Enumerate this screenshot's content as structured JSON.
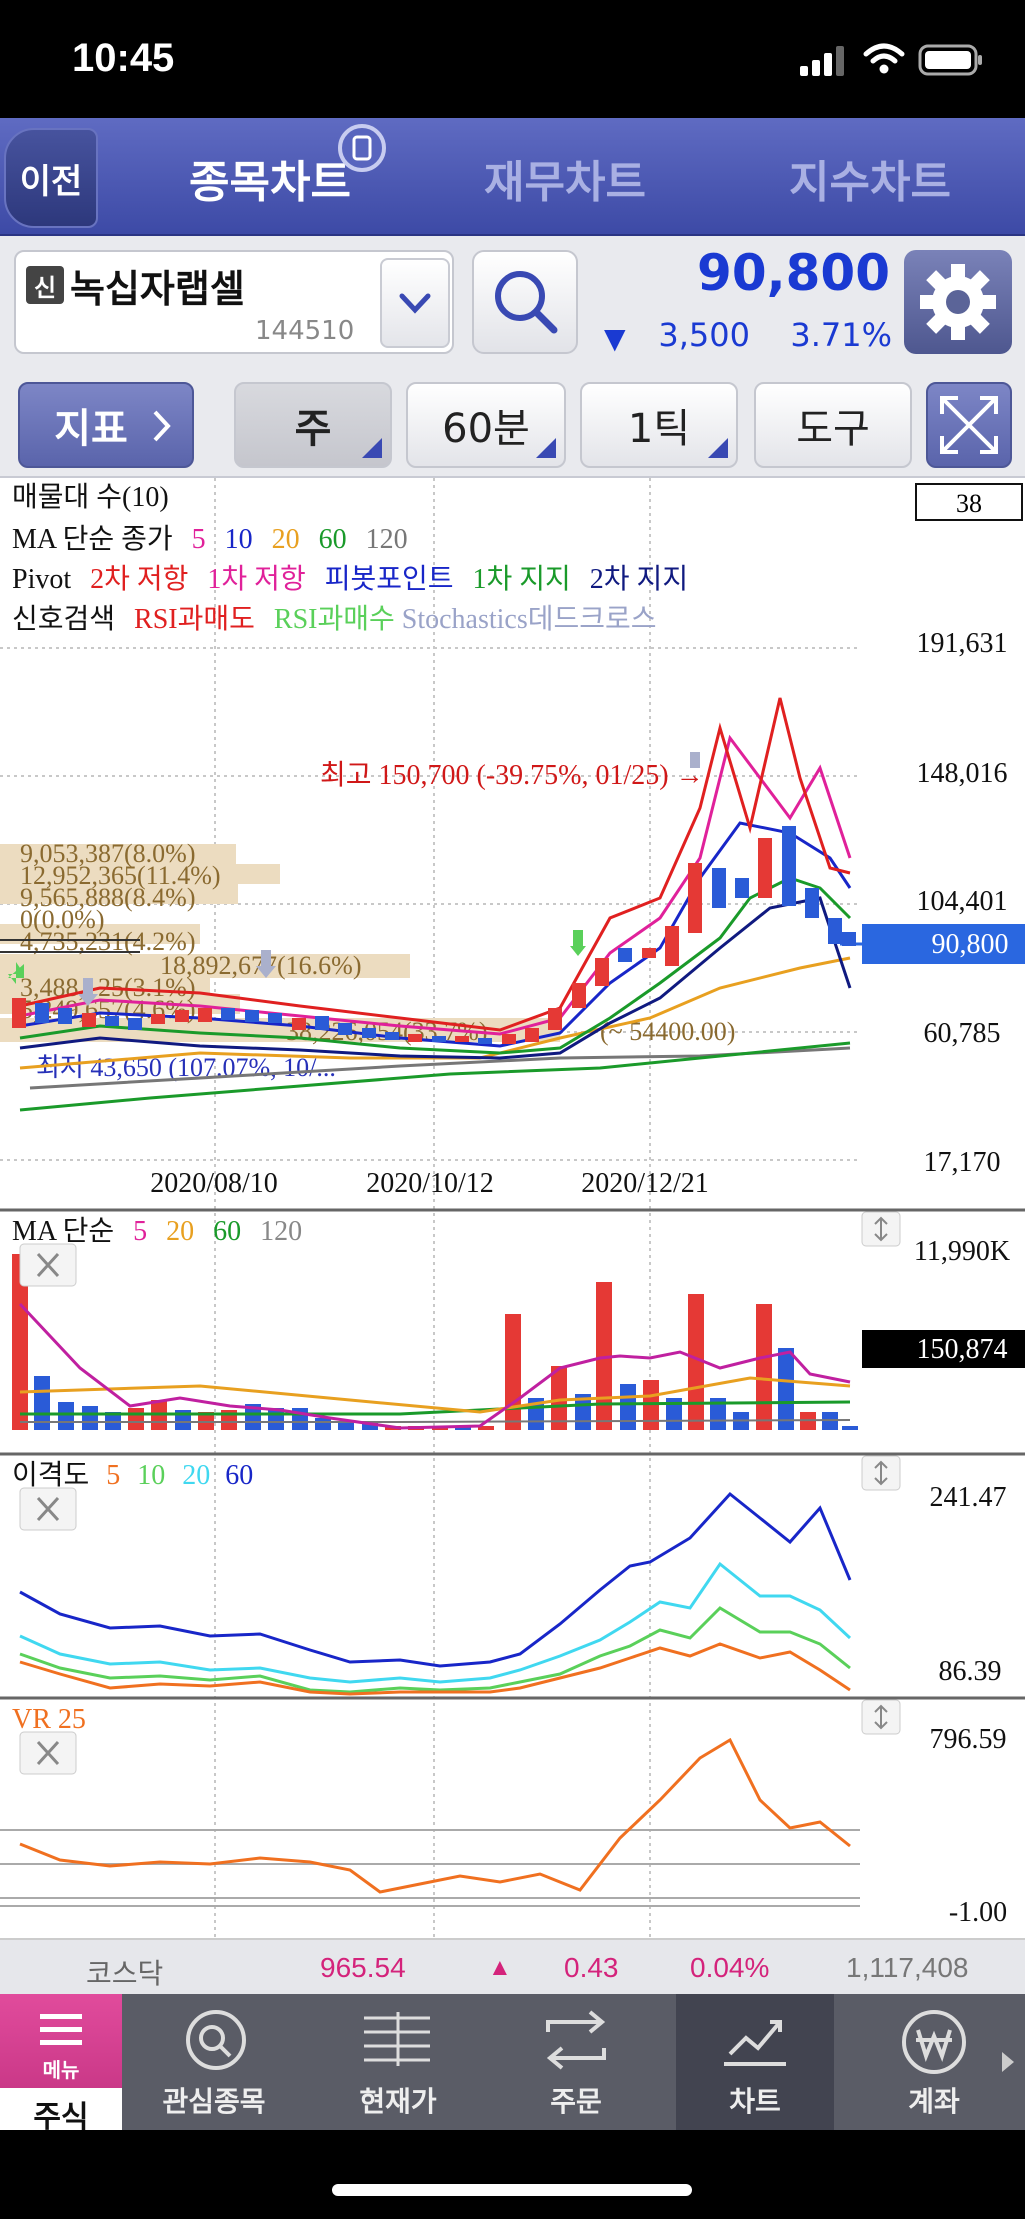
{
  "status_bar": {
    "time": "10:45"
  },
  "nav": {
    "back": "이전",
    "tabs": [
      "종목차트",
      "재무차트",
      "지수차트"
    ]
  },
  "stock": {
    "badge": "신",
    "name": "녹십자랩셀",
    "code": "144510",
    "price": "90,800",
    "change_arrow": "▼",
    "change": "3,500",
    "change_pct": "3.71%"
  },
  "toolbar": {
    "indicator": "지표",
    "period": "주",
    "interval": "60분",
    "tick": "1틱",
    "tools": "도구"
  },
  "main_chart": {
    "legend_rows": [
      [
        {
          "t": "매물대 수(10)",
          "c": "#111"
        }
      ],
      [
        {
          "t": "MA 단순 종가",
          "c": "#111"
        },
        {
          "t": "5",
          "c": "#e0219a"
        },
        {
          "t": "10",
          "c": "#1826c8"
        },
        {
          "t": "20",
          "c": "#e8a020"
        },
        {
          "t": "60",
          "c": "#1a9a2a"
        },
        {
          "t": "120",
          "c": "#777"
        }
      ],
      [
        {
          "t": "Pivot",
          "c": "#111"
        },
        {
          "t": "2차 저항",
          "c": "#e02020"
        },
        {
          "t": "1차 저항",
          "c": "#e0219a"
        },
        {
          "t": "피봇포인트",
          "c": "#1826c8"
        },
        {
          "t": "1차 지지",
          "c": "#1a9a2a"
        },
        {
          "t": "2차 지지",
          "c": "#101a80"
        }
      ],
      [
        {
          "t": "신호검색",
          "c": "#111"
        },
        {
          "t": "RSI과매도",
          "c": "#e02020"
        },
        {
          "t": "RSI과매수",
          "c": "#5ad05a"
        },
        {
          "t": "Stochastics데드크로스",
          "c": "#9aa3c8"
        }
      ]
    ],
    "count_box": "38",
    "y_labels": [
      "191,631",
      "148,016",
      "104,401",
      "60,785",
      "17,170"
    ],
    "current_price_tag": "90,800",
    "x_labels": [
      "2020/08/10",
      "2020/10/12",
      "2020/12/21"
    ],
    "high_annotation": "최고 150,700 (-39.75%, 01/25) →",
    "volume_profile": [
      "9,053,387(8.0%)",
      "12,952,365(11.4%)",
      "9,565,888(8.4%)",
      "0(0.0%)",
      "4,735,231(4.2%)",
      "18,892,677(16.6%)",
      "3,488,125(3.1%)",
      "5,249,657(4.6%)",
      "38,226,054(33.7%)"
    ],
    "range_annotation": "(~ 54400.00)",
    "partial_low_annotation": "최저 43,650 (107.07%, 10/..."
  },
  "volume_chart": {
    "title": "MA 단순",
    "ma": [
      {
        "t": "5",
        "c": "#e0219a"
      },
      {
        "t": "20",
        "c": "#e8a020"
      },
      {
        "t": "60",
        "c": "#1a9a2a"
      },
      {
        "t": "120",
        "c": "#888"
      }
    ],
    "y_top": "11,990K",
    "current": "150,874"
  },
  "disparity_chart": {
    "title": "이격도",
    "periods": [
      {
        "t": "5",
        "c": "#f07020"
      },
      {
        "t": "10",
        "c": "#5ad05a"
      },
      {
        "t": "20",
        "c": "#40d8f0"
      },
      {
        "t": "60",
        "c": "#1826c8"
      }
    ],
    "y_top": "241.47",
    "y_bottom": "86.39"
  },
  "vr_chart": {
    "title": "VR 25",
    "y_top": "796.59",
    "y_bottom": "-1.00"
  },
  "market": {
    "name": "코스닥",
    "value": "965.54",
    "arrow": "▲",
    "change": "0.43",
    "pct": "0.04%",
    "volume": "1,117,408"
  },
  "tabbar": {
    "menu_label": "메뉴",
    "items": [
      "주식",
      "관심종목",
      "현재가",
      "주문",
      "차트",
      "계좌"
    ]
  },
  "colors": {
    "nav_blue": "#4a56b0",
    "price_blue": "#1a3ad2",
    "up_red": "#e53935",
    "down_blue": "#2a5bd7",
    "menu_pink": "#d63a8f"
  }
}
